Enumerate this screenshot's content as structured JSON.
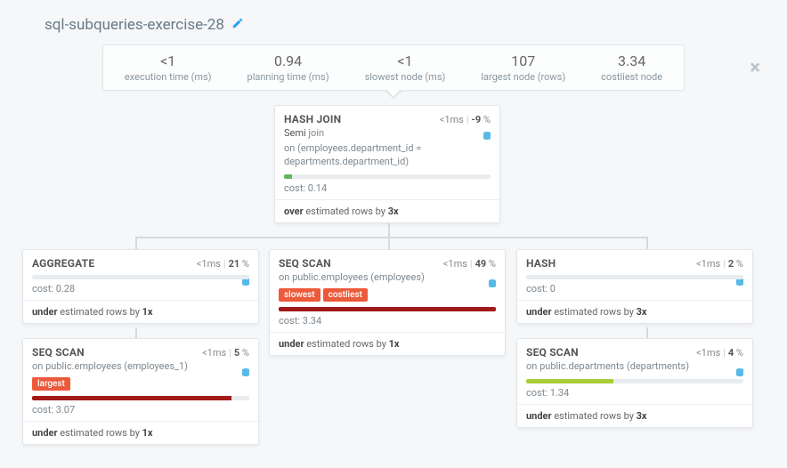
{
  "title": "sql-subqueries-exercise-28",
  "stats": {
    "exec_val": "<1",
    "exec_lbl": "execution time (ms)",
    "plan_val": "0.94",
    "plan_lbl": "planning time (ms)",
    "slow_val": "<1",
    "slow_lbl": "slowest node (ms)",
    "large_val": "107",
    "large_lbl": "largest node (rows)",
    "cost_val": "3.34",
    "cost_lbl": "costliest node"
  },
  "nodes": {
    "hashjoin": {
      "title": "HASH JOIN",
      "time": "<1",
      "pct": "-9",
      "sub1": "Semi",
      "sub2": " join",
      "sub3": "on (employees.department_id = departments.department_id)",
      "cost": "cost: 0.14",
      "est1": "over",
      "est2": " estimated rows by ",
      "est3": "3x"
    },
    "agg": {
      "title": "AGGREGATE",
      "time": "<1",
      "pct": "21",
      "cost": "cost: 0.28",
      "est1": "under",
      "est2": " estimated rows by ",
      "est3": "1x"
    },
    "seq1": {
      "title": "SEQ SCAN",
      "time": "<1",
      "pct": "5",
      "sub": "on public.employees (employees_1)",
      "badge": "largest",
      "cost": "cost: 3.07",
      "est1": "under",
      "est2": " estimated rows by ",
      "est3": "1x"
    },
    "seq2": {
      "title": "SEQ SCAN",
      "time": "<1",
      "pct": "49",
      "sub": "on public.employees (employees)",
      "badgeA": "slowest",
      "badgeB": "costliest",
      "cost": "cost: 3.34",
      "est1": "under",
      "est2": " estimated rows by ",
      "est3": "1x"
    },
    "hash": {
      "title": "HASH",
      "time": "<1",
      "pct": "2",
      "cost": "cost: 0",
      "est1": "under",
      "est2": " estimated rows by ",
      "est3": "3x"
    },
    "seq3": {
      "title": "SEQ SCAN",
      "time": "<1",
      "pct": "4",
      "sub": "on public.departments (departments)",
      "cost": "cost: 1.34",
      "est1": "under",
      "est2": " estimated rows by ",
      "est3": "3x"
    }
  }
}
